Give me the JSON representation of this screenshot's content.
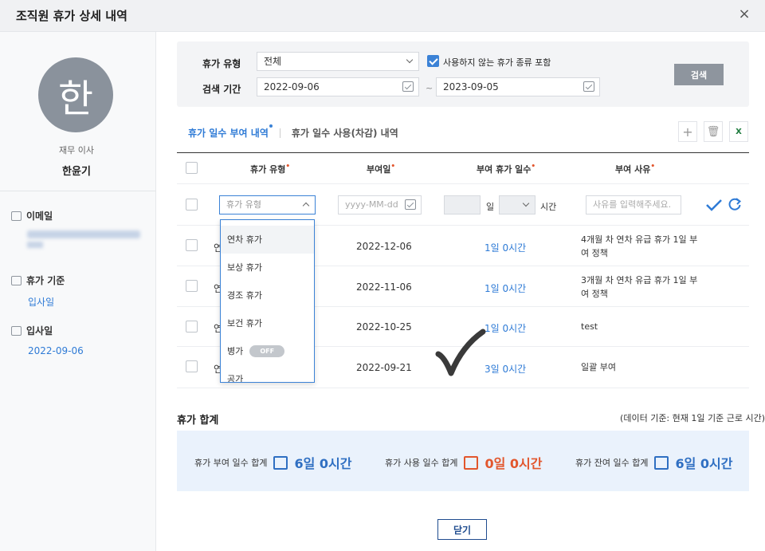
{
  "dialog": {
    "title": "조직원 휴가 상세 내역",
    "close_icon": "×"
  },
  "profile": {
    "avatar_initial": "한",
    "position": "재무 이사",
    "name": "한윤기",
    "email_label": "이메일",
    "email_value": "",
    "basis_label": "휴가 기준",
    "basis_value": "입사일",
    "hire_label": "입사일",
    "hire_value": "2022-09-06"
  },
  "search": {
    "type_label": "휴가 유형",
    "type_value": "전체",
    "include_unused_label": "사용하지 않는 휴가 종류 포함",
    "include_unused_checked": true,
    "period_label": "검색 기간",
    "start_date": "2022-09-06",
    "tilde": "~",
    "end_date": "2023-09-05",
    "search_button": "검색"
  },
  "tabs": {
    "active": "휴가 일수 부여 내역",
    "inactive": "휴가 일수 사용(차감) 내역"
  },
  "toolbar": {
    "add": "+",
    "delete": "🗑",
    "excel": "X"
  },
  "table": {
    "headers": [
      "휴가 유형",
      "부여일",
      "부여 휴가 일수",
      "부여 사유"
    ],
    "required_mark": "•",
    "new_row": {
      "type_placeholder": "휴가 유형",
      "date_placeholder": "yyyy-MM-dd",
      "day_unit": "일",
      "hour_unit": "시간",
      "reason_placeholder": "사유를 입력해주세요."
    },
    "rows": [
      {
        "type_prefix": "연",
        "date": "2022-12-06",
        "days": "1일 0시간",
        "reason": "4개월 차 연차 유급 휴가 1일 부여 정책"
      },
      {
        "type_prefix": "연",
        "date": "2022-11-06",
        "days": "1일 0시간",
        "reason": "3개월 차 연차 유급 휴가 1일 부여 정책"
      },
      {
        "type_prefix": "연",
        "date": "2022-10-25",
        "days": "1일 0시간",
        "reason": "test"
      },
      {
        "type_prefix": "연",
        "date": "2022-09-21",
        "days": "3일 0시간",
        "reason": "일괄 부여"
      }
    ]
  },
  "dropdown": {
    "items": [
      "연차 휴가",
      "보상 휴가",
      "경조 휴가",
      "보건 휴가",
      "병가",
      "공가"
    ],
    "toggle_label": "OFF"
  },
  "summary": {
    "title": "휴가 합계",
    "note": "(데이터 기준: 현재 1일 기준 근로 시간)",
    "granted_label": "휴가 부여 일수 합계",
    "granted_value": "6일 0시간",
    "used_label": "휴가 사용 일수 합계",
    "used_value": "0일 0시간",
    "remaining_label": "휴가 잔여 일수 합계",
    "remaining_value": "6일 0시간"
  },
  "footer": {
    "close_button": "닫기"
  },
  "colors": {
    "accent": "#2f7bd6",
    "danger": "#e2562d",
    "avatar_bg": "#8a929c"
  }
}
